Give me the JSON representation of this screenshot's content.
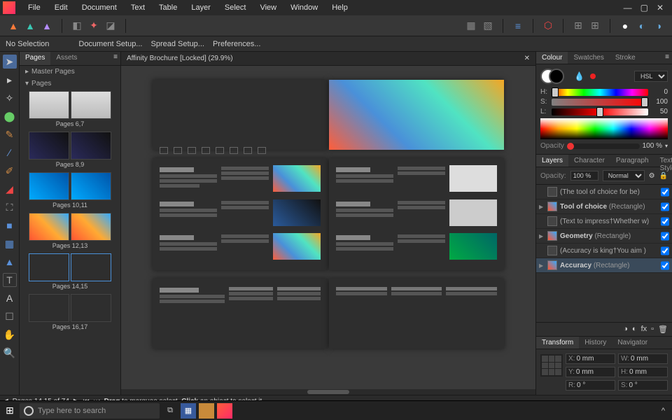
{
  "menu": {
    "items": [
      "File",
      "Edit",
      "Document",
      "Text",
      "Table",
      "Layer",
      "Select",
      "View",
      "Window",
      "Help"
    ]
  },
  "contextbar": {
    "selection": "No Selection",
    "items": [
      "Document Setup...",
      "Spread Setup...",
      "Preferences..."
    ]
  },
  "document": {
    "title": "Affinity Brochure [Locked] (29.9%)"
  },
  "pages_panel": {
    "tabs": [
      "Pages",
      "Assets"
    ],
    "master": "Master Pages",
    "section": "Pages",
    "thumbs": [
      {
        "label": "Pages 6,7"
      },
      {
        "label": "Pages 8,9"
      },
      {
        "label": "Pages 10,11"
      },
      {
        "label": "Pages 12,13"
      },
      {
        "label": "Pages 14,15",
        "selected": true
      },
      {
        "label": "Pages 16,17"
      }
    ]
  },
  "color": {
    "tabs": [
      "Colour",
      "Swatches",
      "Stroke"
    ],
    "mode": "HSL",
    "h": 0,
    "s": 100,
    "l": 50,
    "opacity_label": "Opacity",
    "opacity": "100 %"
  },
  "layers": {
    "tabs": [
      "Layers",
      "Character",
      "Paragraph",
      "Text Styles"
    ],
    "opacity_label": "Opacity:",
    "opacity_val": "100 %",
    "blend": "Normal",
    "items": [
      {
        "name": "(The tool of choice for be)",
        "expandable": false
      },
      {
        "name": "Tool of choice",
        "type": "(Rectangle)",
        "expandable": true,
        "bold": true
      },
      {
        "name": "(Text to impress†Whether w)",
        "expandable": false
      },
      {
        "name": "Geometry",
        "type": "(Rectangle)",
        "expandable": true,
        "bold": true
      },
      {
        "name": "(Accuracy is king†You aim )",
        "expandable": false
      },
      {
        "name": "Accuracy",
        "type": "(Rectangle)",
        "expandable": true,
        "bold": true,
        "selected": true
      }
    ]
  },
  "transform": {
    "tabs": [
      "Transform",
      "History",
      "Navigator"
    ],
    "x": "0 mm",
    "y": "0 mm",
    "w": "0 mm",
    "h": "0 mm",
    "r": "0 °",
    "s": "0 °"
  },
  "status": {
    "pages": "Pages 14,15 of 74",
    "hint_bold1": "Drag",
    "hint1": " to marquee select. ",
    "hint_bold2": "Click",
    "hint2": " an object to select it."
  },
  "taskbar": {
    "search_placeholder": "Type here to search"
  }
}
